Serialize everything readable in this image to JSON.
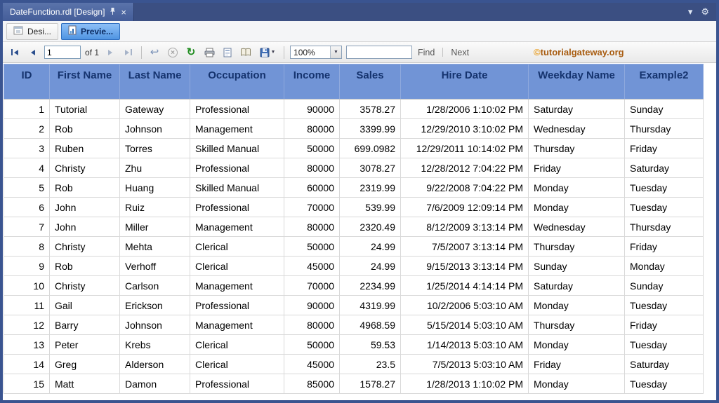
{
  "window": {
    "doc_tab_title": "DateFunction.rdl [Design]",
    "close_glyph": "×"
  },
  "icons": {
    "chevron_down": "▾",
    "gear": "⚙",
    "back": "↩",
    "stop": "×",
    "refresh": "↻",
    "caret_down": "▼"
  },
  "mode_tabs": {
    "design": "Desi...",
    "preview": "Previe..."
  },
  "toolbar": {
    "page_value": "1",
    "page_of_label": "of 1",
    "zoom_value": "100%",
    "find_value": "",
    "find_label": "Find",
    "next_label": "Next",
    "brand_symbol": "©",
    "brand_text": "tutorialgateway.org"
  },
  "table": {
    "columns": [
      "ID",
      "First Name",
      "Last Name",
      "Occupation",
      "Income",
      "Sales",
      "Hire Date",
      "Weekday Name",
      "Example2"
    ],
    "rows": [
      [
        "1",
        "Tutorial",
        "Gateway",
        "Professional",
        "90000",
        "3578.27",
        "1/28/2006 1:10:02 PM",
        "Saturday",
        "Sunday"
      ],
      [
        "2",
        "Rob",
        "Johnson",
        "Management",
        "80000",
        "3399.99",
        "12/29/2010 3:10:02 PM",
        "Wednesday",
        "Thursday"
      ],
      [
        "3",
        "Ruben",
        "Torres",
        "Skilled Manual",
        "50000",
        "699.0982",
        "12/29/2011 10:14:02 PM",
        "Thursday",
        "Friday"
      ],
      [
        "4",
        "Christy",
        "Zhu",
        "Professional",
        "80000",
        "3078.27",
        "12/28/2012 7:04:22 PM",
        "Friday",
        "Saturday"
      ],
      [
        "5",
        "Rob",
        "Huang",
        "Skilled Manual",
        "60000",
        "2319.99",
        "9/22/2008 7:04:22 PM",
        "Monday",
        "Tuesday"
      ],
      [
        "6",
        "John",
        "Ruiz",
        "Professional",
        "70000",
        "539.99",
        "7/6/2009 12:09:14 PM",
        "Monday",
        "Tuesday"
      ],
      [
        "7",
        "John",
        "Miller",
        "Management",
        "80000",
        "2320.49",
        "8/12/2009 3:13:14 PM",
        "Wednesday",
        "Thursday"
      ],
      [
        "8",
        "Christy",
        "Mehta",
        "Clerical",
        "50000",
        "24.99",
        "7/5/2007 3:13:14 PM",
        "Thursday",
        "Friday"
      ],
      [
        "9",
        "Rob",
        "Verhoff",
        "Clerical",
        "45000",
        "24.99",
        "9/15/2013 3:13:14 PM",
        "Sunday",
        "Monday"
      ],
      [
        "10",
        "Christy",
        "Carlson",
        "Management",
        "70000",
        "2234.99",
        "1/25/2014 4:14:14 PM",
        "Saturday",
        "Sunday"
      ],
      [
        "11",
        "Gail",
        "Erickson",
        "Professional",
        "90000",
        "4319.99",
        "10/2/2006 5:03:10 AM",
        "Monday",
        "Tuesday"
      ],
      [
        "12",
        "Barry",
        "Johnson",
        "Management",
        "80000",
        "4968.59",
        "5/15/2014 5:03:10 AM",
        "Thursday",
        "Friday"
      ],
      [
        "13",
        "Peter",
        "Krebs",
        "Clerical",
        "50000",
        "59.53",
        "1/14/2013 5:03:10 AM",
        "Monday",
        "Tuesday"
      ],
      [
        "14",
        "Greg",
        "Alderson",
        "Clerical",
        "45000",
        "23.5",
        "7/5/2013 5:03:10 AM",
        "Friday",
        "Saturday"
      ],
      [
        "15",
        "Matt",
        "Damon",
        "Professional",
        "85000",
        "1578.27",
        "1/28/2013 1:10:02 PM",
        "Monday",
        "Tuesday"
      ]
    ]
  },
  "colors": {
    "header_bg": "#7194d6",
    "header_text": "#15336e",
    "frame": "#3a5490",
    "brand": "#a85c10"
  }
}
